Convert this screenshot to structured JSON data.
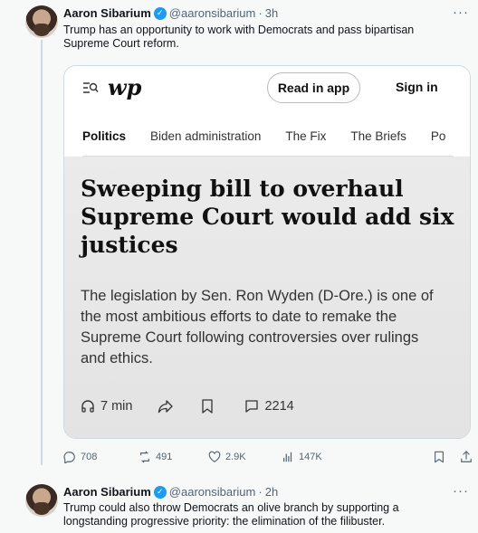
{
  "tweet1": {
    "name": "Aaron Sibarium",
    "handle": "@aaronsibarium",
    "separator": "·",
    "time": "3h",
    "more": "···",
    "text": "Trump has an opportunity to work with Democrats and pass bipartisan Supreme Court reform.",
    "card": {
      "logo": "wp",
      "read_in_app": "Read in app",
      "sign_in": "Sign in",
      "nav": [
        "Politics",
        "Biden administration",
        "The Fix",
        "The Briefs",
        "Po"
      ],
      "headline": "Sweeping bill to overhaul Supreme Court would add six justices",
      "dek": "The legislation by Sen. Ron Wyden (D-Ore.) is one of the most ambitious efforts to date to remake the Supreme Court following controversies over rulings and ethics.",
      "read_time": "7 min",
      "comments": "2214"
    },
    "actions": {
      "replies": "708",
      "reposts": "491",
      "likes": "2.9K",
      "views": "147K"
    }
  },
  "tweet2": {
    "name": "Aaron Sibarium",
    "handle": "@aaronsibarium",
    "separator": "·",
    "time": "2h",
    "more": "···",
    "text": "Trump could also throw Democrats an olive branch by supporting a longstanding progressive priority: the elimination of the filibuster."
  },
  "colors": {
    "verified": "#1d9bf0",
    "muted": "#536471",
    "background": "#f7f9f9"
  }
}
